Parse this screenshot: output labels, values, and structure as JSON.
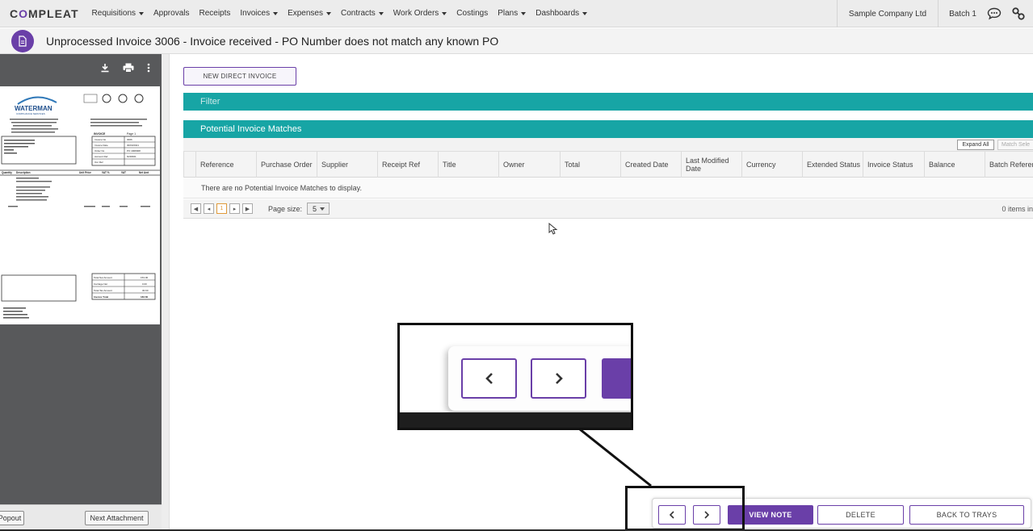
{
  "app": {
    "logo_prefix": "C",
    "logo_o": "O",
    "logo_suffix": "MPLEAT"
  },
  "nav": {
    "items": [
      {
        "label": "Requisitions",
        "has_menu": true
      },
      {
        "label": "Approvals",
        "has_menu": false
      },
      {
        "label": "Receipts",
        "has_menu": false
      },
      {
        "label": "Invoices",
        "has_menu": true
      },
      {
        "label": "Expenses",
        "has_menu": true
      },
      {
        "label": "Contracts",
        "has_menu": true
      },
      {
        "label": "Work Orders",
        "has_menu": true
      },
      {
        "label": "Costings",
        "has_menu": false
      },
      {
        "label": "Plans",
        "has_menu": true
      },
      {
        "label": "Dashboards",
        "has_menu": true
      }
    ],
    "company": "Sample Company Ltd",
    "batch": "Batch 1",
    "icons": [
      "chat-icon",
      "link-icon"
    ]
  },
  "titlebar": {
    "icon": "document-icon",
    "title": "Unprocessed Invoice 3006 - Invoice received - PO Number does not match any known PO"
  },
  "doc_viewer": {
    "toolbar_icons": [
      "download-icon",
      "print-icon",
      "more-vert-icon"
    ],
    "popout_label": "Popout",
    "next_attachment_label": "Next Attachment",
    "invoice": {
      "brand": "WATERMAN",
      "brand_sub": "COMPLIANCE SERVICES",
      "heading": "INVOICE",
      "page": "Page 1",
      "fields": [
        {
          "label": "Invoice No",
          "value": "3006"
        },
        {
          "label": "Invoice Date",
          "value": "30/03/2021"
        },
        {
          "label": "Order No",
          "value": "PO 4008008"
        },
        {
          "label": "Account Ref",
          "value": "NOR001"
        },
        {
          "label": "Our Ref",
          "value": ""
        }
      ],
      "columns": [
        "Quantity",
        "Description",
        "Unit Price",
        "VAT %",
        "VAT",
        "Net Amt"
      ],
      "totals": [
        {
          "label": "Total Net Amount",
          "value": "153.00"
        },
        {
          "label": "Carriage Net",
          "value": "0.00"
        },
        {
          "label": "Total Tax Amount",
          "value": "30.60"
        },
        {
          "label": "Invoice Total",
          "value": "183.60"
        }
      ]
    }
  },
  "main": {
    "new_direct_invoice": "NEW DIRECT INVOICE",
    "filter_label": "Filter",
    "pim_label": "Potential Invoice Matches",
    "expand_all": "Expand All",
    "match_selected": "Match Sele",
    "columns": [
      "Reference",
      "Purchase Order",
      "Supplier",
      "Receipt Ref",
      "Title",
      "Owner",
      "Total",
      "Created Date",
      "Last Modified Date",
      "Currency",
      "Extended Status",
      "Invoice Status",
      "Balance",
      "Batch Referen"
    ],
    "empty_message": "There are no Potential Invoice Matches to display.",
    "pager": {
      "current_page": "1",
      "page_size_label": "Page size:",
      "page_size_value": "5",
      "items_info": "0 items in"
    }
  },
  "actions": {
    "prev_icon": "chevron-left-icon",
    "next_icon": "chevron-right-icon",
    "view_note": "VIEW NOTE",
    "delete": "DELETE",
    "back_to_trays": "BACK TO TRAYS"
  },
  "colors": {
    "brand_purple": "#6a3fa8",
    "teal": "#17a5a5",
    "doc_pane": "#58595b"
  }
}
